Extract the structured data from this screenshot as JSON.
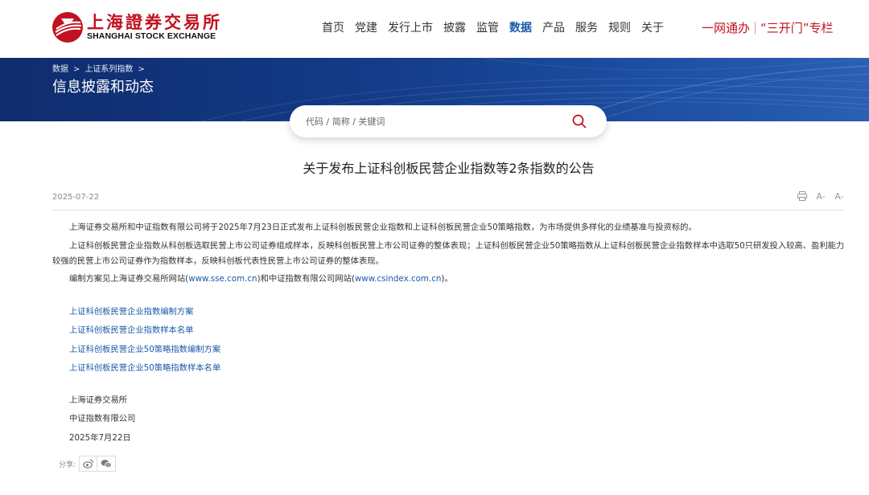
{
  "logo": {
    "cn": "上海證券交易所",
    "en": "SHANGHAI STOCK EXCHANGE",
    "brand_color": "#c1121f"
  },
  "nav": {
    "items": [
      {
        "label": "首页"
      },
      {
        "label": "党建"
      },
      {
        "label": "发行上市"
      },
      {
        "label": "披露"
      },
      {
        "label": "监管"
      },
      {
        "label": "数据",
        "active": true
      },
      {
        "label": "产品"
      },
      {
        "label": "服务"
      },
      {
        "label": "规则"
      },
      {
        "label": "关于"
      }
    ],
    "active_color": "#1a5aa8"
  },
  "header_right": {
    "link1": "一网通办",
    "link2": "“三开门”专栏"
  },
  "breadcrumb": {
    "item1": "数据",
    "item2": "上证系列指数",
    "sep": ">"
  },
  "page_title": "信息披露和动态",
  "search": {
    "placeholder": "代码 / 简称 / 关键词"
  },
  "article": {
    "title": "关于发布上证科创板民营企业指数等2条指数的公告",
    "date": "2025-07-22",
    "tools": {
      "print": "print-icon",
      "font_down": "A-",
      "font_up": "A-"
    },
    "para1": "上海证券交易所和中证指数有限公司将于2025年7月23日正式发布上证科创板民营企业指数和上证科创板民营企业50策略指数，为市场提供多样化的业绩基准与投资标的。",
    "para2": "上证科创板民营企业指数从科创板选取民营上市公司证券组成样本，反映科创板民营上市公司证券的整体表现；上证科创板民营企业50策略指数从上证科创板民营企业指数样本中选取50只研发投入较高、盈利能力较强的民营上市公司证券作为指数样本，反映科创板代表性民营上市公司证券的整体表现。",
    "para3_a": "编制方案见上海证券交易所网站(",
    "para3_link1": "www.sse.com.cn",
    "para3_b": ")和中证指数有限公司网站(",
    "para3_link2": "www.csindex.com.cn",
    "para3_c": ")。",
    "links": [
      "上证科创板民营企业指数编制方案",
      "上证科创板民营企业指数样本名单",
      "上证科创板民营企业50策略指数编制方案",
      "上证科创板民营企业50策略指数样本名单"
    ],
    "sign": {
      "org1": "上海证券交易所",
      "org2": "中证指数有限公司",
      "date": "2025年7月22日"
    },
    "share_label": "分享:"
  }
}
